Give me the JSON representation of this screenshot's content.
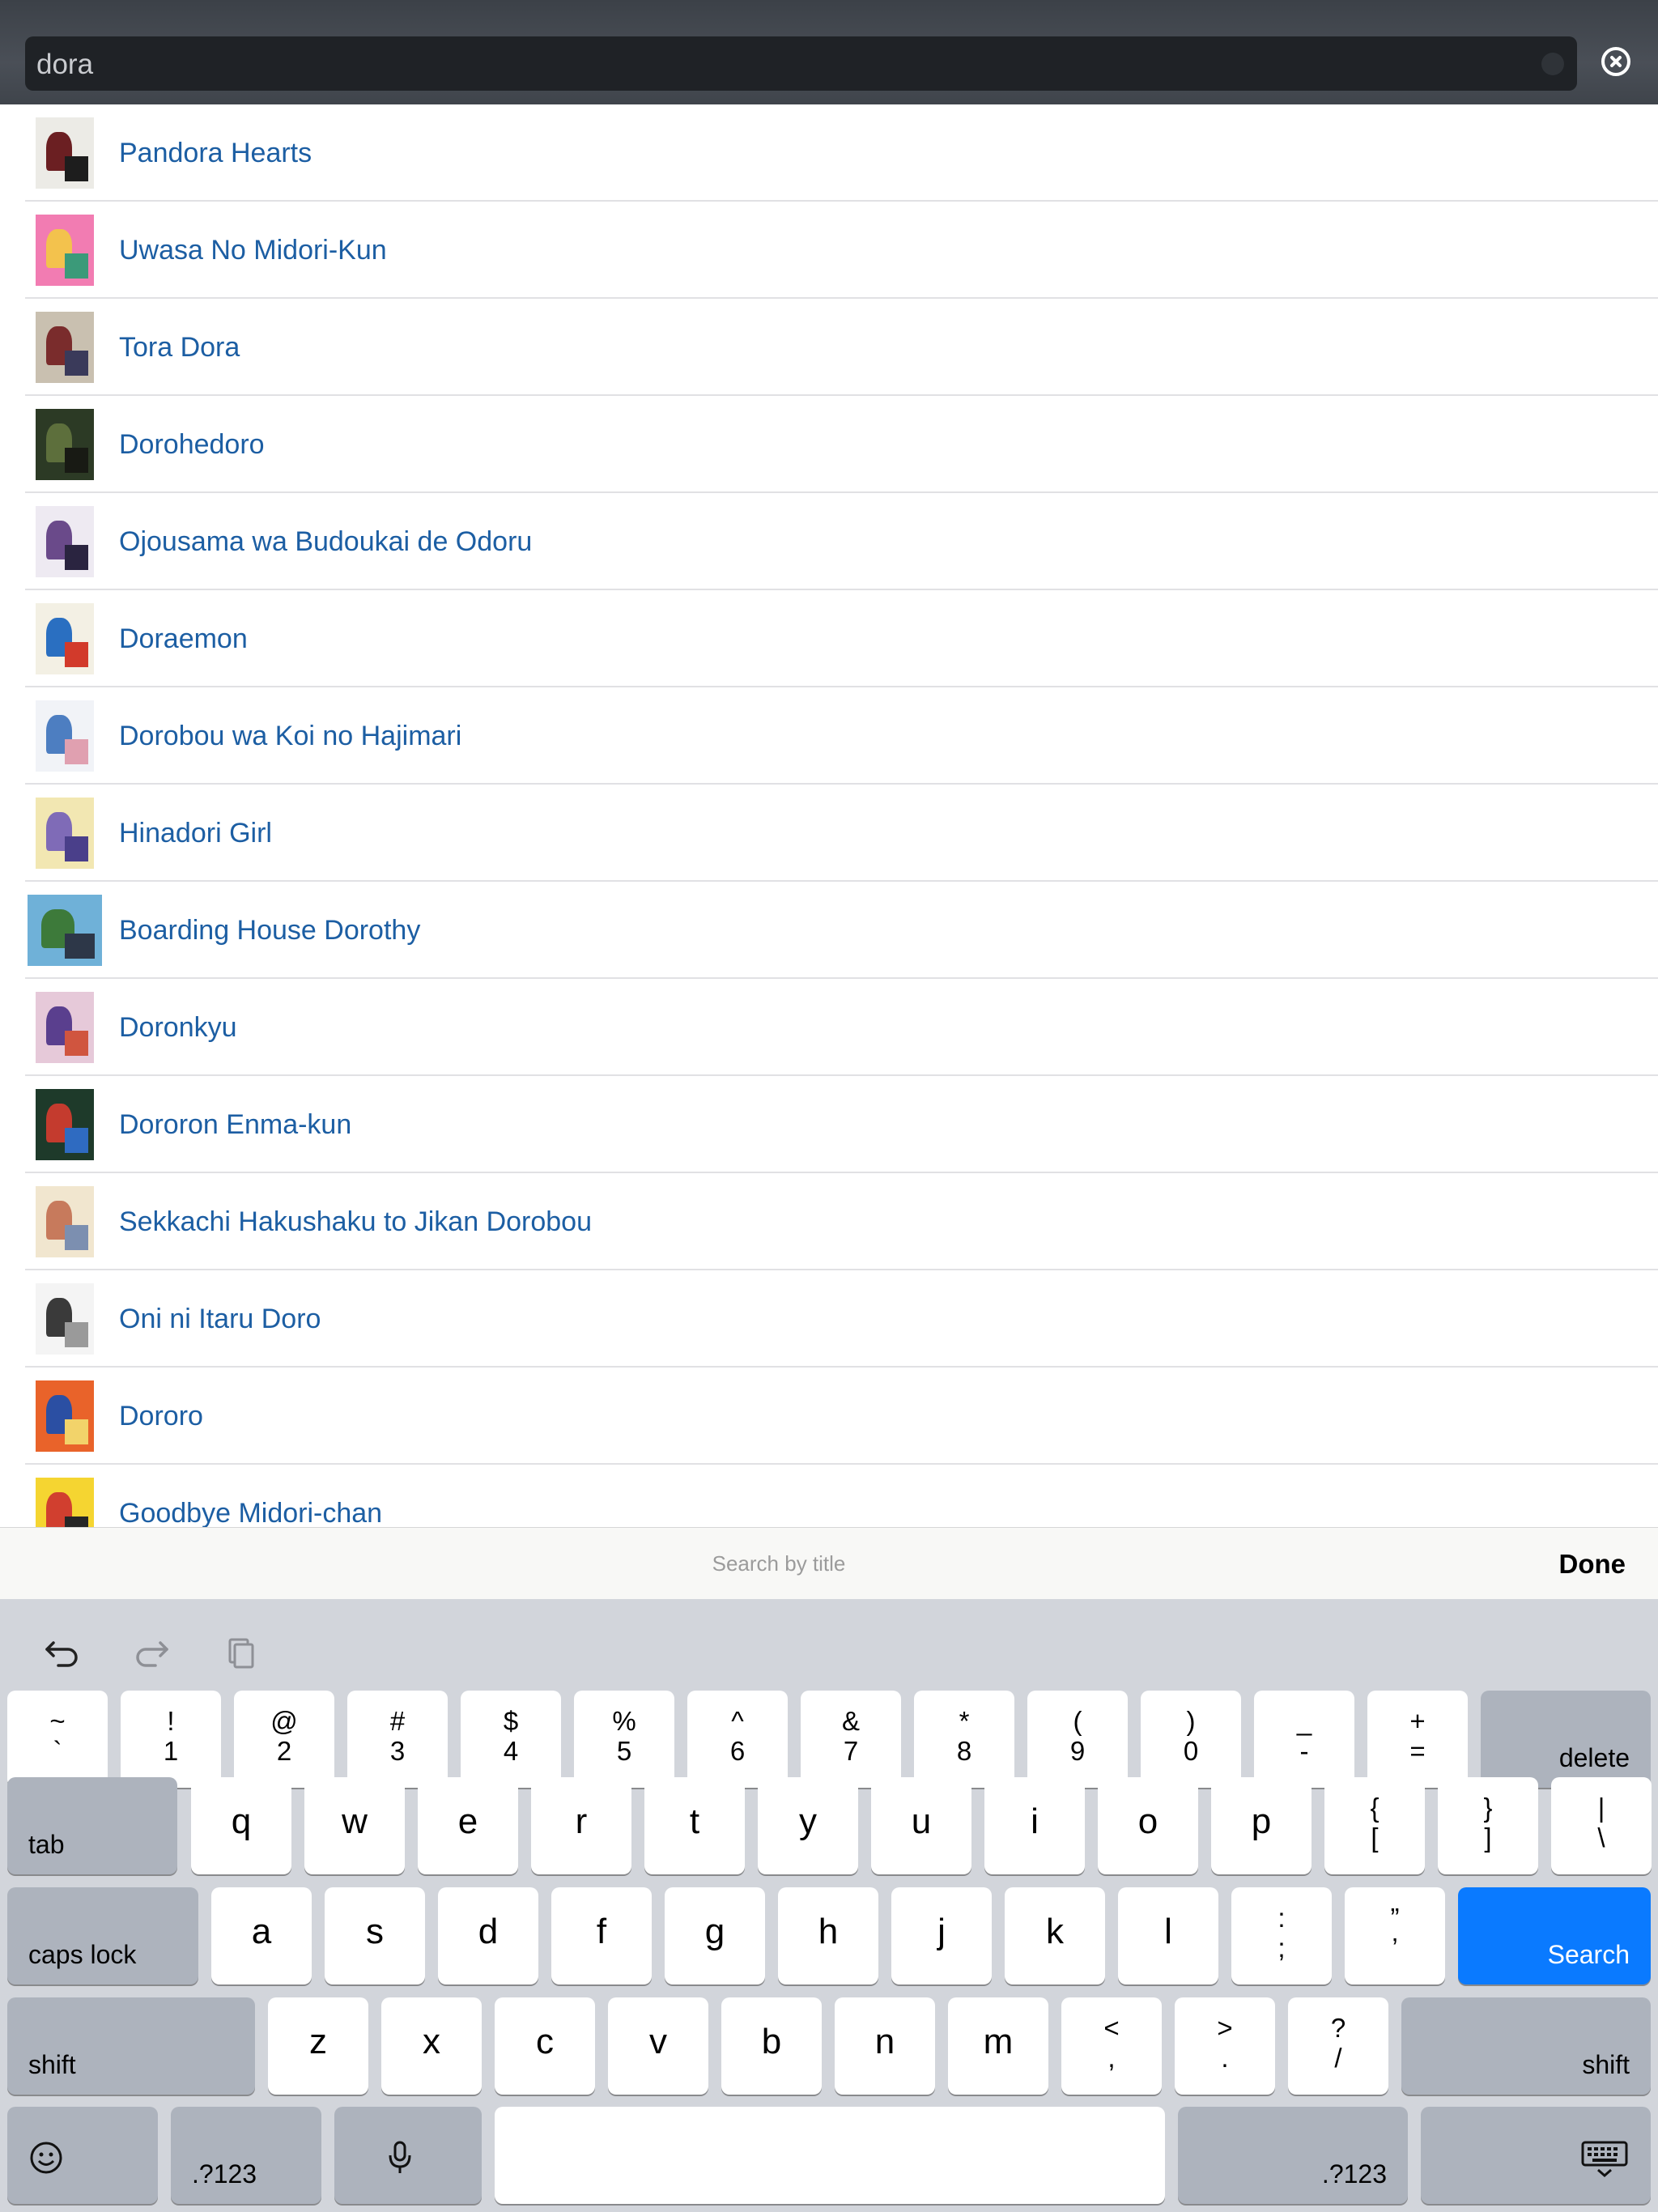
{
  "search": {
    "value": "dora"
  },
  "results": [
    {
      "title": "Pandora Hearts",
      "colors": [
        "#ecebe6",
        "#6b1f22",
        "#1d1d1d"
      ]
    },
    {
      "title": "Uwasa No Midori-Kun",
      "colors": [
        "#f27cb2",
        "#f3c24d",
        "#3b9a79"
      ]
    },
    {
      "title": "Tora Dora",
      "colors": [
        "#c9c0b0",
        "#7a2c2c",
        "#3a3a5a"
      ]
    },
    {
      "title": "Dorohedoro",
      "colors": [
        "#2c3a25",
        "#5d6f3c",
        "#181a14"
      ]
    },
    {
      "title": "Ojousama wa Budoukai de Odoru",
      "colors": [
        "#eeeaf2",
        "#6a4a8a",
        "#2a2440"
      ]
    },
    {
      "title": "Doraemon",
      "colors": [
        "#f3f0e4",
        "#2a6fc1",
        "#d23a2b"
      ]
    },
    {
      "title": "Dorobou wa Koi no Hajimari",
      "colors": [
        "#f1f3f7",
        "#4d7ec1",
        "#e0a0b0"
      ]
    },
    {
      "title": "Hinadori Girl",
      "colors": [
        "#f2e7b2",
        "#7f6bb7",
        "#4a3f8a"
      ]
    },
    {
      "title": "Boarding House Dorothy",
      "colors": [
        "#6fb1d8",
        "#3d7a3a",
        "#2d3748"
      ]
    },
    {
      "title": "Doronkyu",
      "colors": [
        "#e6c9d9",
        "#5a3f8e",
        "#d0553f"
      ]
    },
    {
      "title": "Dororon Enma-kun",
      "colors": [
        "#1e3a2a",
        "#c43b2e",
        "#2f6bc1"
      ]
    },
    {
      "title": "Sekkachi Hakushaku to Jikan Dorobou",
      "colors": [
        "#f1e6cf",
        "#c77a5c",
        "#7c8fb0"
      ]
    },
    {
      "title": "Oni ni Itaru Doro",
      "colors": [
        "#f4f4f4",
        "#3a3a3a",
        "#9a9a9a"
      ]
    },
    {
      "title": "Dororo",
      "colors": [
        "#e9632a",
        "#2b4fa3",
        "#f2d36a"
      ]
    },
    {
      "title": "Goodbye Midori-chan",
      "colors": [
        "#f5d531",
        "#d13f2f",
        "#262626"
      ]
    }
  ],
  "accessory": {
    "hint": "Search by title",
    "done": "Done"
  },
  "keyboard": {
    "toolbar": [
      "undo-icon",
      "redo-icon",
      "paste-icon"
    ],
    "row1": [
      {
        "up": "~",
        "down": "`"
      },
      {
        "up": "!",
        "down": "1"
      },
      {
        "up": "@",
        "down": "2"
      },
      {
        "up": "#",
        "down": "3"
      },
      {
        "up": "$",
        "down": "4"
      },
      {
        "up": "%",
        "down": "5"
      },
      {
        "up": "^",
        "down": "6"
      },
      {
        "up": "&",
        "down": "7"
      },
      {
        "up": "*",
        "down": "8"
      },
      {
        "up": "(",
        "down": "9"
      },
      {
        "up": ")",
        "down": "0"
      },
      {
        "up": "_",
        "down": "-"
      },
      {
        "up": "+",
        "down": "="
      }
    ],
    "delete": "delete",
    "tab": "tab",
    "row2": [
      "q",
      "w",
      "e",
      "r",
      "t",
      "y",
      "u",
      "i",
      "o",
      "p"
    ],
    "row2_sym": [
      {
        "up": "{",
        "down": "["
      },
      {
        "up": "}",
        "down": "]"
      },
      {
        "up": "|",
        "down": "\\"
      }
    ],
    "caps_lock": "caps lock",
    "row3": [
      "a",
      "s",
      "d",
      "f",
      "g",
      "h",
      "j",
      "k",
      "l"
    ],
    "row3_sym": [
      {
        "up": ":",
        "down": ";"
      },
      {
        "up": "”",
        "down": "’"
      }
    ],
    "search": "Search",
    "shift": "shift",
    "row4": [
      "z",
      "x",
      "c",
      "v",
      "b",
      "n",
      "m"
    ],
    "row4_sym": [
      {
        "up": "<",
        "down": ","
      },
      {
        "up": ">",
        "down": "."
      },
      {
        "up": "?",
        "down": "/"
      }
    ],
    "numbers": ".?123",
    "accent_color": "#0a7aff"
  }
}
